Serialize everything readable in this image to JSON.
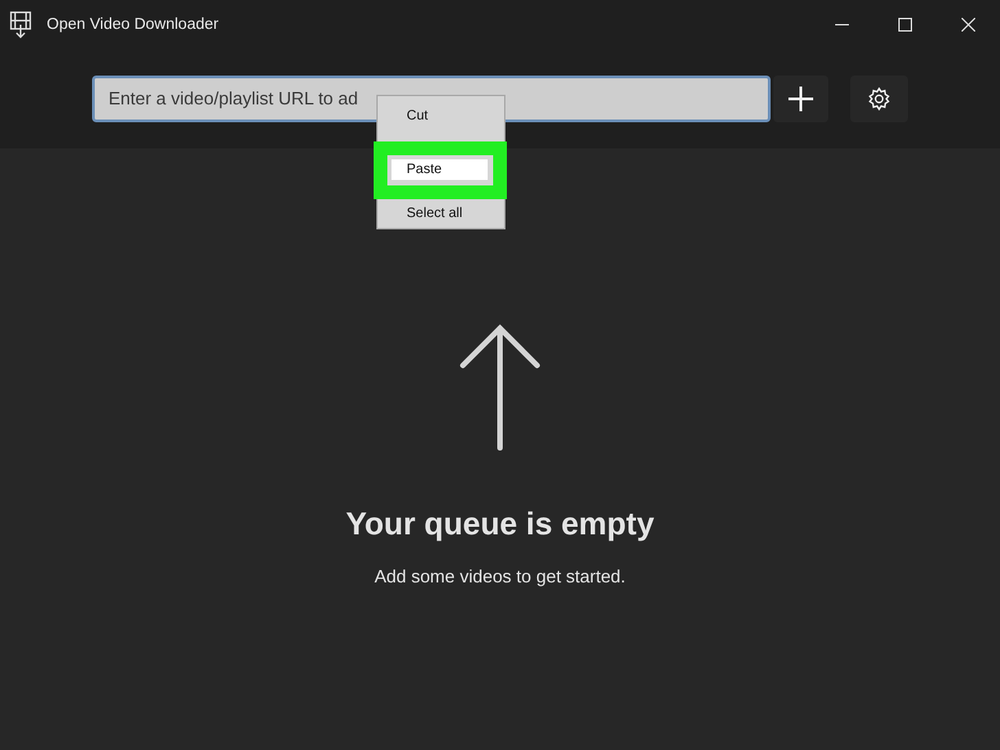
{
  "window": {
    "title": "Open Video Downloader"
  },
  "url_field": {
    "placeholder": "Enter a video/playlist URL to ad"
  },
  "context_menu": {
    "items": [
      {
        "label": "Cut",
        "selected": false
      },
      {
        "label": "Paste",
        "selected": true
      },
      {
        "label": "Select all",
        "selected": false
      }
    ]
  },
  "empty_state": {
    "title": "Your queue is empty",
    "message": "Add some videos to get started."
  }
}
